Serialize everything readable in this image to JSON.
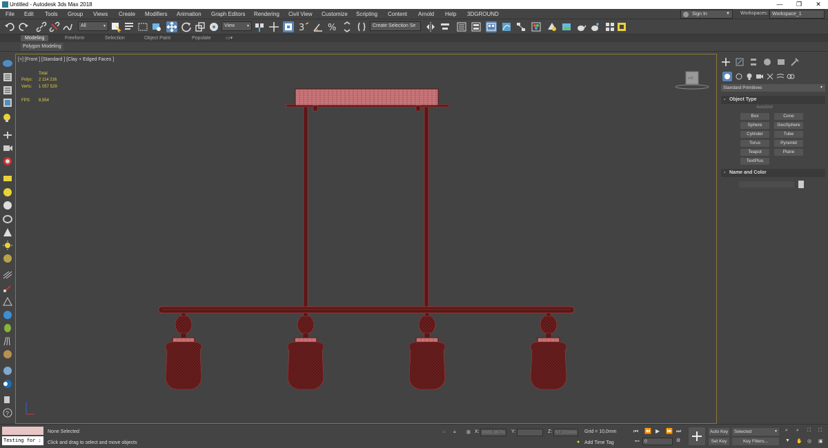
{
  "window": {
    "title": "Untitled - Autodesk 3ds Max 2018",
    "minimize": "—",
    "maximize": "❐",
    "close": "✕"
  },
  "menu": [
    "File",
    "Edit",
    "Tools",
    "Group",
    "Views",
    "Create",
    "Modifiers",
    "Animation",
    "Graph Editors",
    "Rendering",
    "Civil View",
    "Customize",
    "Scripting",
    "Content",
    "Arnold",
    "Help",
    "3DGROUND"
  ],
  "account": {
    "signin": "Sign In",
    "workspaces_label": "Workspaces:",
    "workspace": "Workspace_1"
  },
  "toolbar": {
    "filter": "All",
    "refcoord": "View",
    "selection_set": "Create Selection Se",
    "snap_angle": "3"
  },
  "ribbon": {
    "tabs": [
      "Modeling",
      "Freeform",
      "Selection",
      "Object Paint",
      "Populate"
    ],
    "active_tab": "Modeling",
    "panel": "Polygon Modeling"
  },
  "viewport": {
    "label": "[+] [Front ] [Standard ] [Clay + Edged Faces ]",
    "stats": {
      "total_label": "Total",
      "polys_label": "Polys:",
      "polys": "2 114 216",
      "verts_label": "Verts:",
      "verts": "1 057 529",
      "fps_label": "FPS:",
      "fps": "8,954"
    },
    "viewcube": "left"
  },
  "command_panel": {
    "category": "Standard Primitives",
    "object_type_title": "Object Type",
    "autogrid": "AutoGrid",
    "primitives": [
      "Box",
      "Cone",
      "Sphere",
      "GeoSphere",
      "Cylinder",
      "Tube",
      "Torus",
      "Pyramid",
      "Teapot",
      "Plane",
      "TextPlus"
    ],
    "name_color_title": "Name and Color"
  },
  "status": {
    "script_text": "Testing for :",
    "selection": "None Selected",
    "prompt": "Click and drag to select and move objects",
    "x_label": "X:",
    "x": "8383,367m",
    "y_label": "Y:",
    "y": "",
    "z_label": "Z:",
    "z": "97,221mm",
    "grid": "Grid = 10,0mm",
    "add_time_tag": "Add Time Tag",
    "frame": "0",
    "auto_key": "Auto Key",
    "set_key": "Set Key",
    "key_mode": "Selected",
    "key_filters": "Key Filters..."
  },
  "colors": {
    "model": "#5a1717",
    "model_edge": "#a33c3c",
    "viewport_border": "#8a7a35",
    "active_blue": "#5b86b5"
  }
}
